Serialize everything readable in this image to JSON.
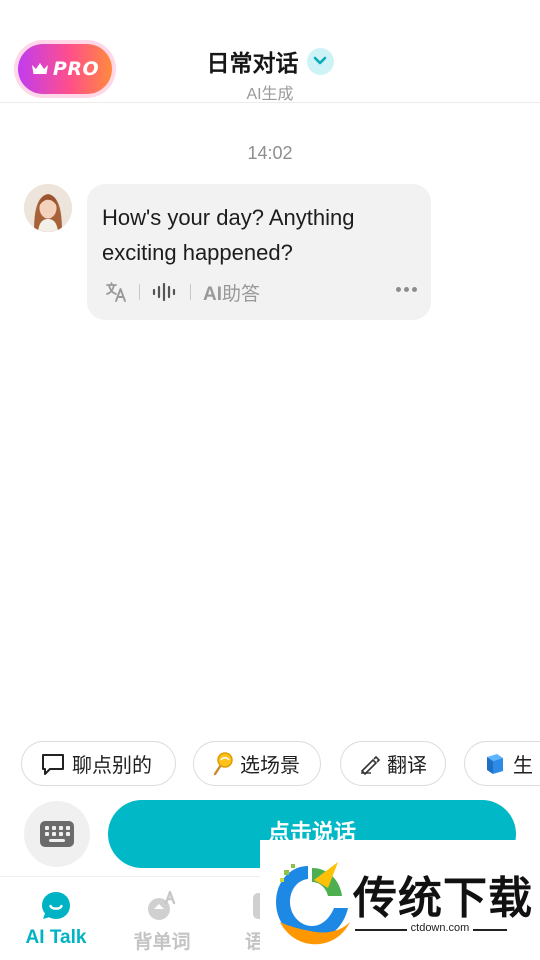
{
  "header": {
    "pro_label": "PRO",
    "title": "日常对话",
    "subtitle": "AI生成"
  },
  "chat": {
    "timestamp": "14:02",
    "messages": [
      {
        "text_line1": "How's your day? Anything",
        "text_line2": "exciting happened?",
        "ai_answer_prefix": "AI",
        "ai_answer_suffix": "助答"
      }
    ]
  },
  "suggestions": [
    {
      "label": "聊点别的",
      "icon": "chat-bubble-icon"
    },
    {
      "label": "选场景",
      "icon": "lollipop-icon"
    },
    {
      "label": "翻译",
      "icon": "writing-hand-icon"
    },
    {
      "label": "生",
      "icon": "book-icon"
    }
  ],
  "input": {
    "talk_label": "点击说话"
  },
  "tabs": [
    {
      "label": "AI Talk",
      "active": true
    },
    {
      "label": "背单词",
      "active": false
    },
    {
      "label": "语法",
      "active": false
    }
  ],
  "watermark": {
    "brand": "传统下载",
    "domain": "ctdown.com"
  },
  "colors": {
    "accent": "#00b8c6",
    "pro_gradient_start": "#c13cf0",
    "pro_gradient_end": "#ff8a3d",
    "bubble_bg": "#f2f2f2"
  }
}
